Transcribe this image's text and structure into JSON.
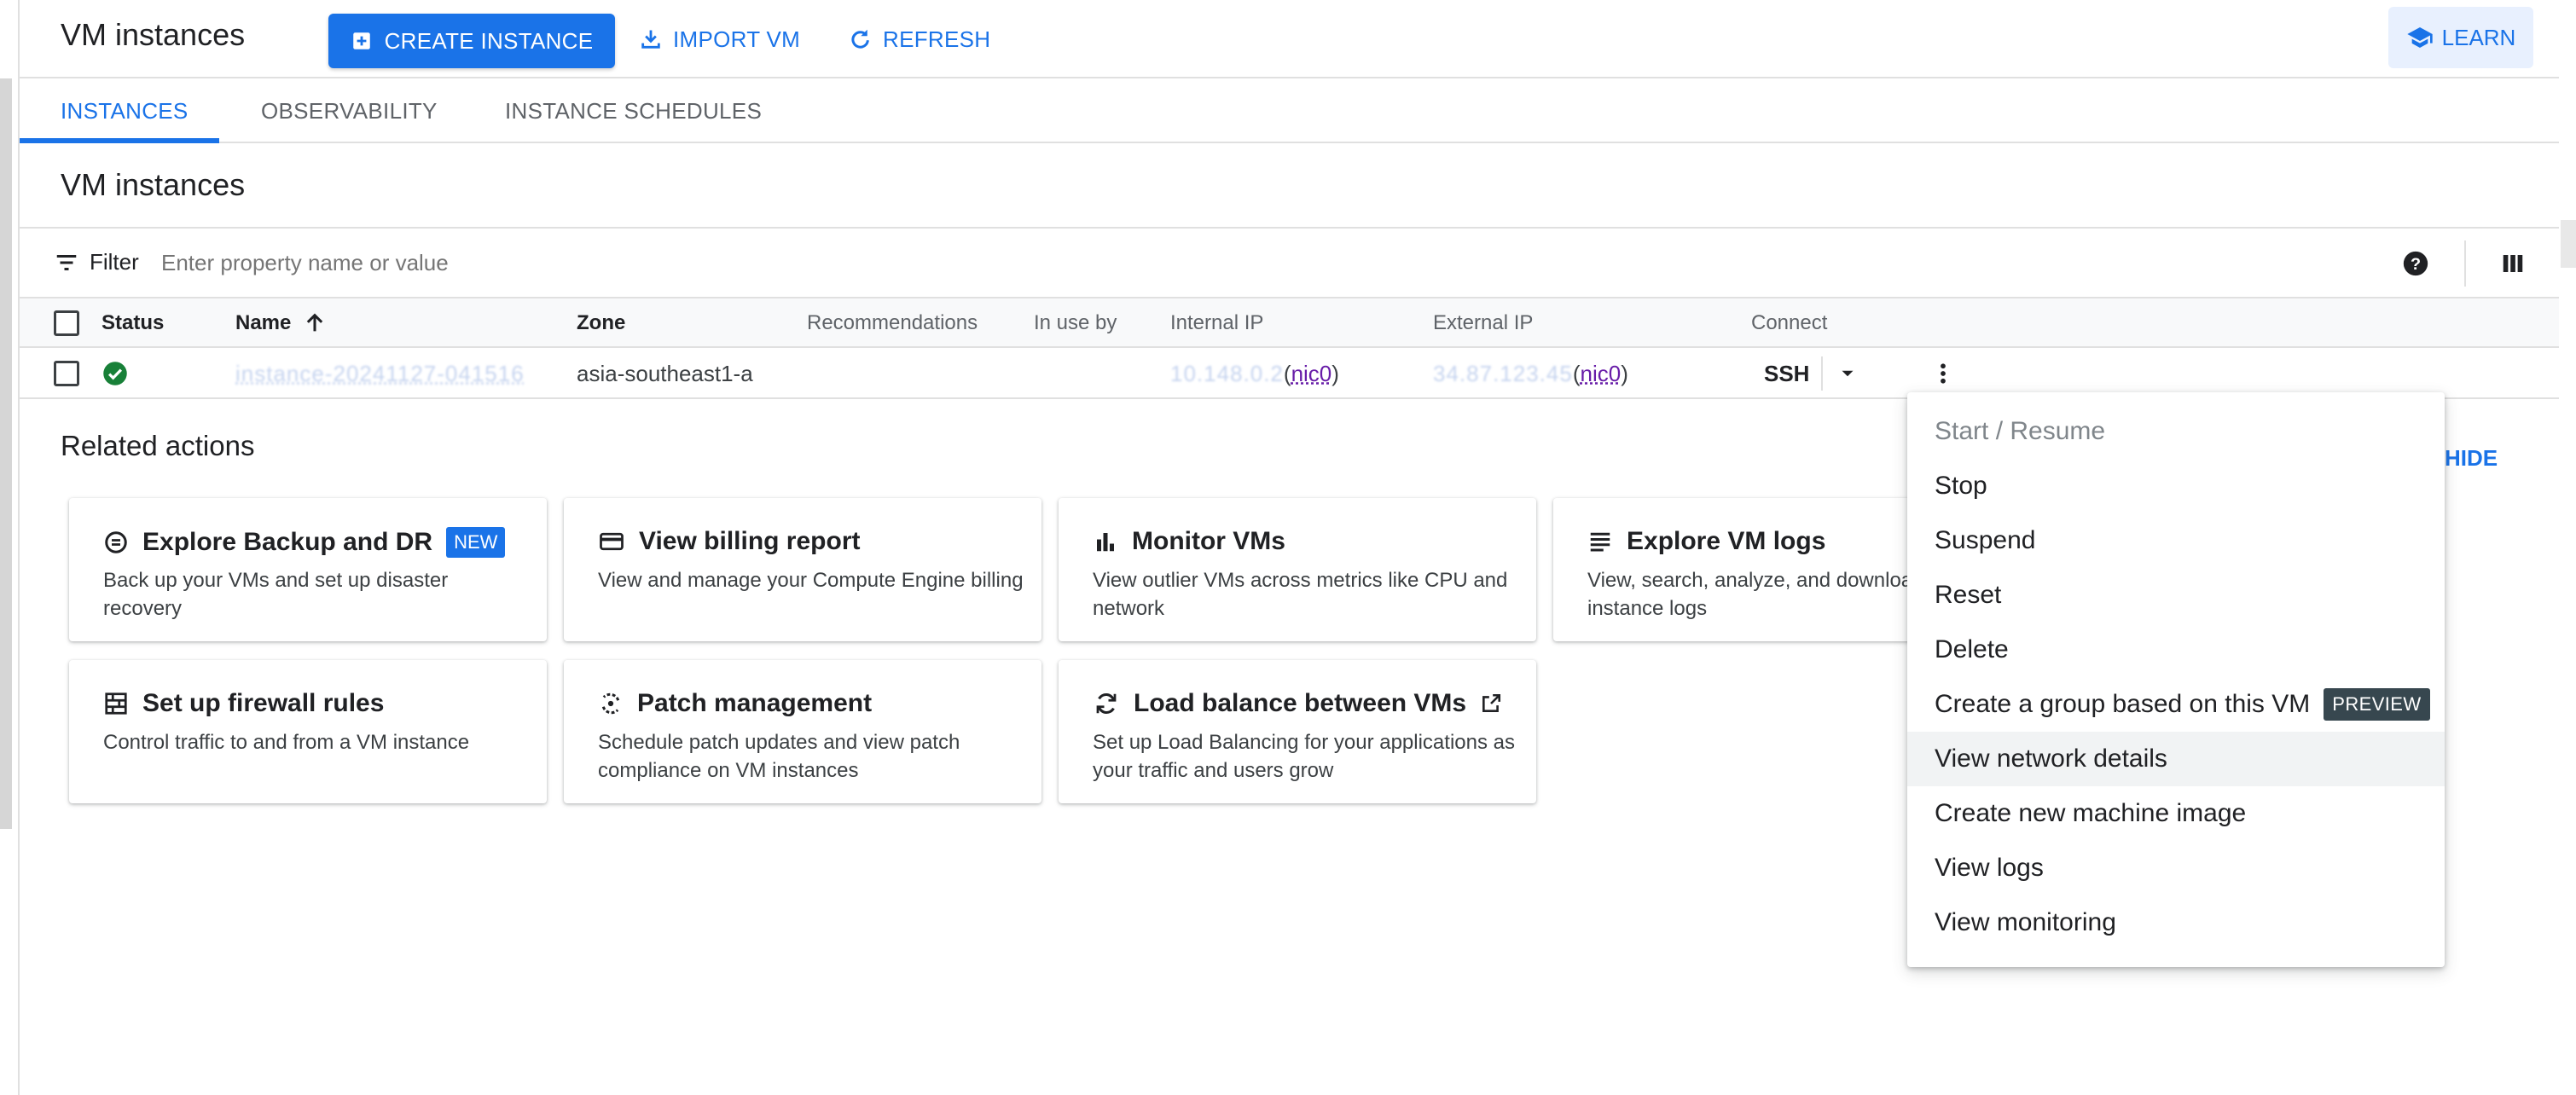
{
  "header": {
    "title": "VM instances",
    "create_label": "CREATE INSTANCE",
    "import_label": "IMPORT VM",
    "refresh_label": "REFRESH",
    "learn_label": "LEARN"
  },
  "tabs": [
    {
      "label": "INSTANCES",
      "active": true
    },
    {
      "label": "OBSERVABILITY",
      "active": false
    },
    {
      "label": "INSTANCE SCHEDULES",
      "active": false
    }
  ],
  "section_title": "VM instances",
  "filter": {
    "label": "Filter",
    "placeholder": "Enter property name or value"
  },
  "table": {
    "columns": [
      "Status",
      "Name",
      "Zone",
      "Recommendations",
      "In use by",
      "Internal IP",
      "External IP",
      "Connect"
    ],
    "sorted_by": "Name",
    "rows": [
      {
        "name": "instance-20241127-041516",
        "zone": "asia-southeast1-a",
        "internal_ip": "10.148.0.2",
        "internal_nic": "nic0",
        "external_ip": "34.87.123.45",
        "external_nic": "nic0",
        "connect": "SSH"
      }
    ]
  },
  "related": {
    "title": "Related actions",
    "hide_label": "HIDE",
    "cards": [
      {
        "title": "Explore Backup and DR",
        "badge": "NEW",
        "desc": "Back up your VMs and set up disaster recovery",
        "icon": "backup-icon"
      },
      {
        "title": "View billing report",
        "desc": "View and manage your Compute Engine billing",
        "icon": "credit-card-icon"
      },
      {
        "title": "Monitor VMs",
        "desc": "View outlier VMs across metrics like CPU and network",
        "icon": "bar-chart-icon"
      },
      {
        "title": "Explore VM logs",
        "desc": "View, search, analyze, and download VM instance logs",
        "icon": "logs-icon"
      },
      {
        "title": "Set up firewall rules",
        "desc": "Control traffic to and from a VM instance",
        "icon": "firewall-icon"
      },
      {
        "title": "Patch management",
        "desc": "Schedule patch updates and view patch compliance on VM instances",
        "icon": "patch-icon"
      },
      {
        "title": "Load balance between VMs",
        "desc": "Set up Load Balancing for your applications as your traffic and users grow",
        "icon": "load-balance-icon"
      }
    ]
  },
  "menu": {
    "items": [
      {
        "label": "Start / Resume",
        "disabled": true
      },
      {
        "label": "Stop"
      },
      {
        "label": "Suspend"
      },
      {
        "label": "Reset"
      },
      {
        "label": "Delete"
      },
      {
        "label": "Create a group based on this VM",
        "badge": "PREVIEW"
      },
      {
        "label": "View network details",
        "hover": true
      },
      {
        "label": "Create new machine image"
      },
      {
        "label": "View logs"
      },
      {
        "label": "View monitoring"
      }
    ]
  },
  "colors": {
    "accent": "#1a73e8",
    "status_ok": "#188038",
    "nic_link": "#681da8",
    "preview_badge": "#37474f"
  }
}
